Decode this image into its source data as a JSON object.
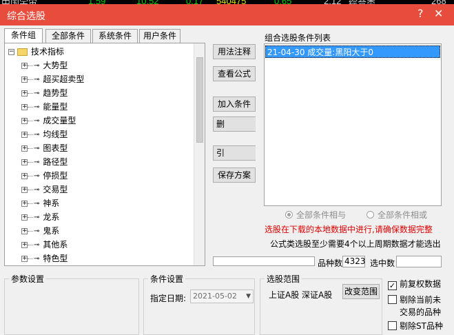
{
  "ticker": {
    "items": [
      "中国宇宙",
      "1.59",
      "10.52",
      "0.17",
      "540475",
      "0.65",
      "2.12",
      "综合类",
      "268"
    ]
  },
  "window": {
    "title": "综合选股",
    "help_glyph": "?",
    "close_glyph": "✕"
  },
  "tabs": [
    "条件组",
    "全部条件",
    "系统条件",
    "用户条件"
  ],
  "tree": {
    "root": "技术指标",
    "items": [
      "大势型",
      "超买超卖型",
      "趋势型",
      "能量型",
      "成交量型",
      "均线型",
      "图表型",
      "路径型",
      "停损型",
      "交易型",
      "神系",
      "龙系",
      "鬼系",
      "其他系",
      "特色型"
    ]
  },
  "buttons": {
    "usage": "用法注释",
    "view_formula": "查看公式",
    "add_condition": "加入条件",
    "delete_partial": "删",
    "import_partial": "引",
    "save_plan": "保存方案",
    "change_scope": "改变范围"
  },
  "condition_list": {
    "label": "组合选股条件列表",
    "items": [
      "21-04-30 成交量:黑阳大于0"
    ]
  },
  "logic": {
    "all_and": "全部条件相与",
    "all_or": "全部条件相或"
  },
  "notes": {
    "local_data": "选股在下载的本地数据中进行,请确保数据完整",
    "formula_note": "公式类选股至少需要4个以上周期数据才能选出"
  },
  "counts": {
    "variety_label": "品种数",
    "variety_value": "4323",
    "selected_label": "选中数",
    "selected_value": ""
  },
  "params": {
    "title": "参数设置"
  },
  "condition_settings": {
    "title": "条件设置",
    "date_label": "指定日期:",
    "date_value": "2021-05-02"
  },
  "scope": {
    "title": "选股范围",
    "markets": "上证A股 深证A股"
  },
  "options": {
    "forward_adjust": "前复权数据",
    "exclude_suspended_1": "剔除当前未",
    "exclude_suspended_2": "交易的品种",
    "exclude_st": "剔除ST品种"
  },
  "colors": {
    "title_bar": "#e84c3d",
    "selection": "#3399ff",
    "warning": "#e00000"
  }
}
